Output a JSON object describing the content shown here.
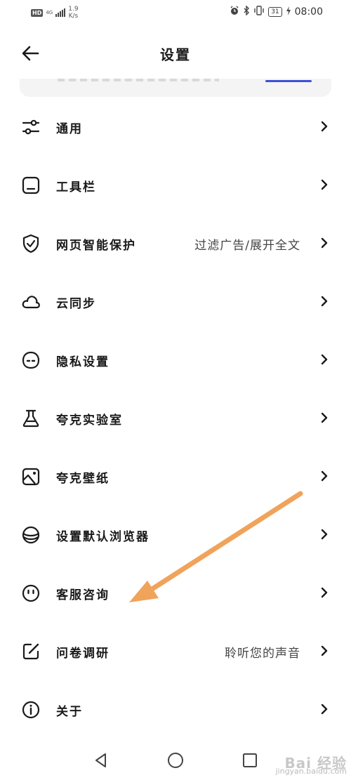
{
  "status_bar": {
    "hd": "HD",
    "network": "4G",
    "speed_value": "1.9",
    "speed_unit": "K/s",
    "battery": "31",
    "time": "08:00"
  },
  "header": {
    "title": "设置"
  },
  "menu": [
    {
      "label": "通用",
      "icon": "sliders-icon"
    },
    {
      "label": "工具栏",
      "icon": "toolbar-icon"
    },
    {
      "label": "网页智能保护",
      "value": "过滤广告/展开全文",
      "icon": "shield-check-icon"
    },
    {
      "label": "云同步",
      "icon": "cloud-icon"
    },
    {
      "label": "隐私设置",
      "icon": "privacy-face-icon"
    },
    {
      "label": "夸克实验室",
      "icon": "flask-icon"
    },
    {
      "label": "夸克壁纸",
      "icon": "wallpaper-icon"
    },
    {
      "label": "设置默认浏览器",
      "icon": "browser-stack-icon"
    },
    {
      "label": "客服咨询",
      "icon": "smile-icon"
    },
    {
      "label": "问卷调研",
      "value": "聆听您的声音",
      "icon": "edit-icon"
    },
    {
      "label": "关于",
      "icon": "info-icon"
    }
  ],
  "watermark": {
    "brand": "Bai 经验",
    "url": "jingyan.baidu.com"
  },
  "colors": {
    "accent_blue": "#3d4fd6",
    "annotation_arrow": "#f0a35a",
    "text": "#1a1a1a"
  }
}
